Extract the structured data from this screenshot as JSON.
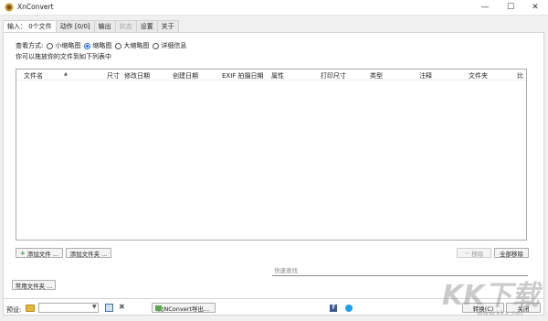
{
  "window": {
    "title": "XnConvert",
    "controls": {
      "minimize": "—",
      "maximize": "☐",
      "close": "✕"
    }
  },
  "tabs": [
    {
      "label": "输入： 0个文件",
      "state": "active"
    },
    {
      "label": "动作 [0/0]",
      "state": "normal"
    },
    {
      "label": "输出",
      "state": "normal"
    },
    {
      "label": "状态",
      "state": "disabled"
    },
    {
      "label": "设置",
      "state": "normal"
    },
    {
      "label": "关于",
      "state": "normal"
    }
  ],
  "view": {
    "label": "查看方式:",
    "options": [
      {
        "label": "小缩略图",
        "selected": false
      },
      {
        "label": "缩略图",
        "selected": true
      },
      {
        "label": "大缩略图",
        "selected": false
      },
      {
        "label": "详细信息",
        "selected": false
      }
    ],
    "hint": "你可以拖放你的文件到如下列表中"
  },
  "columns": [
    "文件名",
    "尺寸",
    "修改日期",
    "创建日期",
    "EXIF 拍摄日期",
    "属性",
    "打印尺寸",
    "类型",
    "注释",
    "文件夹",
    "比"
  ],
  "buttons": {
    "add_file": "添加文件 ...",
    "add_folder": "添加文件夹 ...",
    "remove": "移除",
    "remove_all": "全部移除",
    "common_folder": "常用文件夹 ...",
    "export": "为NConvert导出...",
    "convert": "转换(C)",
    "close": "关闭"
  },
  "search": {
    "placeholder": "快速查找"
  },
  "bottom": {
    "preset_label": "预设:",
    "preset_value": ""
  },
  "watermark": {
    "logo": "KK下载",
    "url": "www.kkx.net"
  }
}
